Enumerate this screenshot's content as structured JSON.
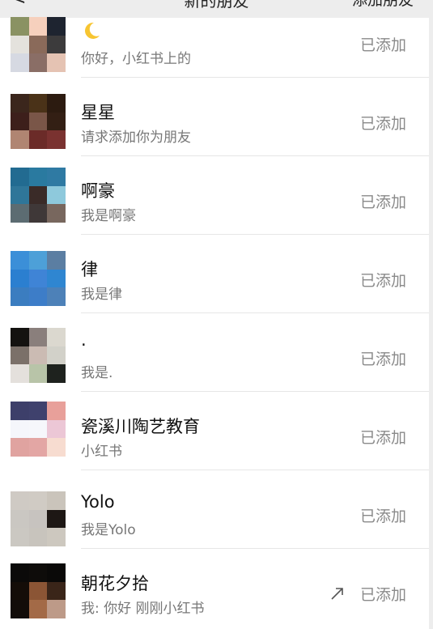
{
  "header": {
    "back_label": "<",
    "title": "新的朋友",
    "action": "添加朋友"
  },
  "friends": [
    {
      "name": "",
      "name_icon": "crescent-moon-emoji",
      "message": "你好，小红书上的",
      "status": "已添加",
      "avatar": [
        "#8a9263",
        "#f6d0bd",
        "#1e2430",
        "#e4e2dd",
        "#8a6a5a",
        "#3c3b3c",
        "#d6d9e2",
        "#8a6e66",
        "#e5c3b3"
      ]
    },
    {
      "name": "星星",
      "message": "请求添加你为朋友",
      "status": "已添加",
      "avatar": [
        "#3b261c",
        "#4a3218",
        "#2c1b10",
        "#3d1f1b",
        "#7a5648",
        "#331f14",
        "#b08572",
        "#6b2b28",
        "#7a3230"
      ]
    },
    {
      "name": "啊豪",
      "message": "我是啊豪",
      "status": "已添加",
      "avatar": [
        "#226b91",
        "#2a7aa0",
        "#2f7aa3",
        "#2f7699",
        "#3a2b28",
        "#8ec9dc",
        "#5c6c72",
        "#3f3838",
        "#78675e"
      ]
    },
    {
      "name": "律",
      "message": "我是律",
      "status": "已添加",
      "avatar": [
        "#3b8fd8",
        "#4da0d8",
        "#5b7ea2",
        "#2b7fd0",
        "#3f84d6",
        "#2f86d1",
        "#3b7dc0",
        "#3d7dc8",
        "#4d81b8"
      ]
    },
    {
      "name": "·",
      "message": "我是.",
      "status": "已添加",
      "avatar": [
        "#141210",
        "#8a7f7c",
        "#dbd8cf",
        "#7b7069",
        "#cbbbb3",
        "#d2d1c9",
        "#e4e0dc",
        "#b8c4a8",
        "#1e221e"
      ]
    },
    {
      "name": "瓷溪川陶艺教育",
      "message": "小红书",
      "status": "已添加",
      "avatar": [
        "#3d3f6a",
        "#3f416d",
        "#e8a09a",
        "#f5f6fb",
        "#f6f7fb",
        "#ecc7d6",
        "#e0a3a0",
        "#e3a6a4",
        "#f7dcd0"
      ]
    },
    {
      "name": "Yolo",
      "message": "我是Yolo",
      "status": "已添加",
      "avatar": [
        "#cfcac4",
        "#d0cbc4",
        "#cac4bb",
        "#cac7c2",
        "#c7c3bf",
        "#1d1714",
        "#cbc8c2",
        "#c8c4bd",
        "#cdc8bf"
      ]
    },
    {
      "name": "朝花夕拾",
      "message": "我: 你好 刚刚小红书",
      "status": "已添加",
      "avatar": [
        "#0b0a09",
        "#0e0c0a",
        "#0a0908",
        "#140d08",
        "#8b5535",
        "#3a2519",
        "#120c09",
        "#a36a47",
        "#bd9a88"
      ],
      "has_arrow": true
    }
  ]
}
